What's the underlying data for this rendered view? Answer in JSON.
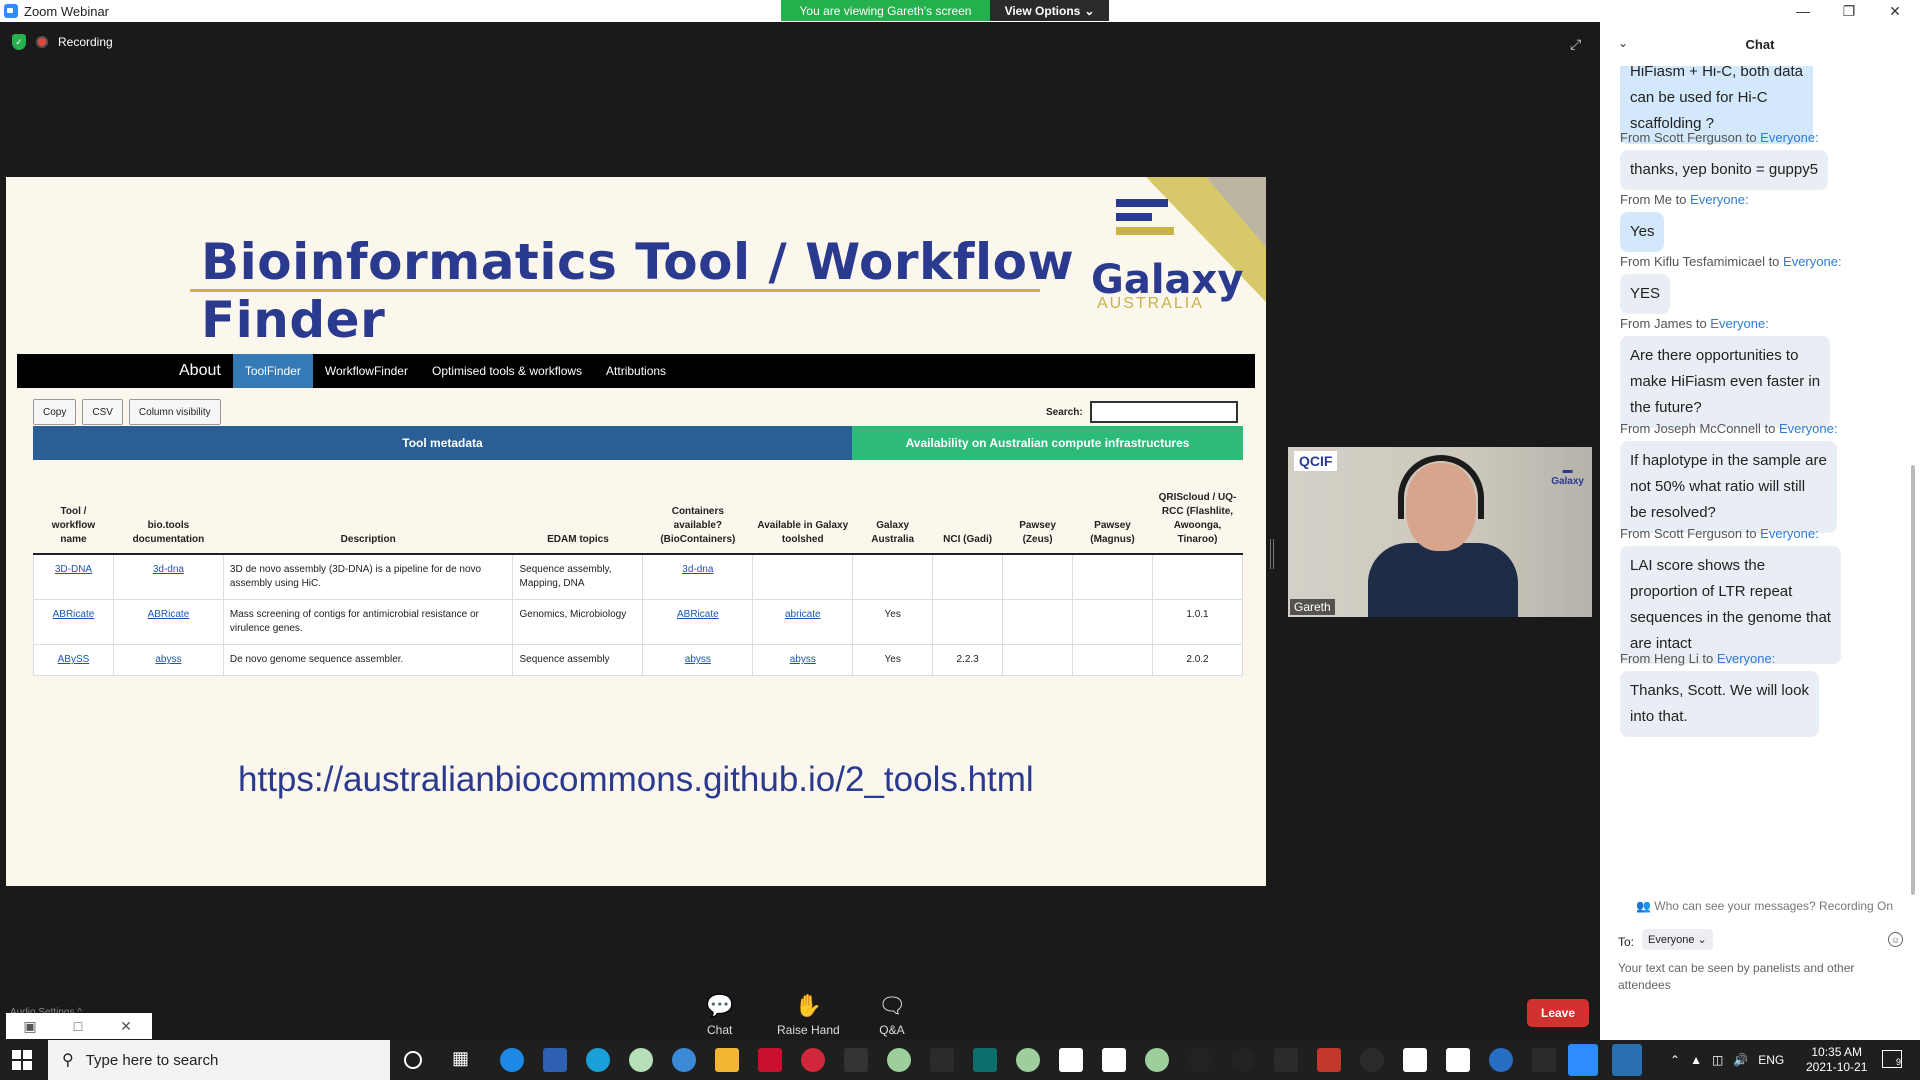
{
  "window": {
    "app_title": "Zoom Webinar"
  },
  "banner": {
    "viewing_text": "You are viewing Gareth's screen",
    "view_options_label": "View Options"
  },
  "meeting": {
    "recording_label": "Recording"
  },
  "slide": {
    "title": "Bioinformatics Tool  / Workflow Finder",
    "logo_name": "Galaxy",
    "logo_sub": "AUSTRALIA",
    "url": "https://australianbiocommons.github.io/2_tools.html",
    "nav": {
      "brand": "About",
      "items": [
        "ToolFinder",
        "WorkflowFinder",
        "Optimised tools & workflows",
        "Attributions"
      ]
    },
    "buttons": [
      "Copy",
      "CSV",
      "Column visibility"
    ],
    "search_label": "Search:",
    "band_meta": "Tool metadata",
    "band_avail": "Availability on Australian compute infrastructures",
    "table": {
      "headers": [
        "Tool / workflow name",
        "bio.tools documentation",
        "Description",
        "EDAM topics",
        "Containers available? (BioContainers)",
        "Available in Galaxy toolshed",
        "Galaxy Australia",
        "NCI (Gadi)",
        "Pawsey (Zeus)",
        "Pawsey (Magnus)",
        "QRIScloud / UQ-RCC (Flashlite, Awoonga, Tinaroo)"
      ],
      "rows": [
        [
          "3D-DNA",
          "3d-dna",
          "3D de novo assembly (3D-DNA) is a pipeline for de novo assembly using HiC.",
          "Sequence assembly, Mapping, DNA",
          "3d-dna",
          "",
          "",
          "",
          "",
          "",
          ""
        ],
        [
          "ABRicate",
          "ABRicate",
          "Mass screening of contigs for antimicrobial resistance or virulence genes.",
          "Genomics, Microbiology",
          "ABRicate",
          "abricate",
          "Yes",
          "",
          "",
          "",
          "1.0.1"
        ],
        [
          "ABySS",
          "abyss",
          "De novo genome sequence assembler.",
          "Sequence assembly",
          "abyss",
          "abyss",
          "Yes",
          "2.2.3",
          "",
          "",
          "2.0.2"
        ]
      ]
    }
  },
  "video": {
    "participant_name": "Gareth",
    "org_label": "QCIF",
    "tile_logo": "Galaxy"
  },
  "controls": {
    "chat": "Chat",
    "raise_hand": "Raise Hand",
    "qa": "Q&A",
    "leave": "Leave",
    "audio_settings": "Audio Settings ^"
  },
  "chat": {
    "header": "Chat",
    "partial_message": "HiFiasm + Hi-C, both data\ncan be used for Hi-C\nscaffolding ?",
    "messages": [
      {
        "from": "From Scott Ferguson to ",
        "to": "Everyone:",
        "text": "thanks, yep bonito = guppy5"
      },
      {
        "from": "From Me to ",
        "to": "Everyone:",
        "text": "Yes"
      },
      {
        "from": "From Kiflu Tesfamimicael to ",
        "to": "Everyone:",
        "text": "YES"
      },
      {
        "from": "From James to ",
        "to": "Everyone:",
        "text": "Are there opportunities to\nmake HiFiasm even faster in\nthe future?"
      },
      {
        "from": "From Joseph McConnell to ",
        "to": "Everyone:",
        "text": "If haplotype in the sample are\nnot 50% what ratio will still\nbe resolved?"
      },
      {
        "from": "From Scott Ferguson to ",
        "to": "Everyone:",
        "text": "LAI score shows the\nproportion of LTR repeat\nsequences in the genome that\nare intact"
      },
      {
        "from": "From Heng Li to ",
        "to": "Everyone:",
        "text": "Thanks, Scott. We will look\ninto that."
      }
    ],
    "who_can_see": "Who can see your messages? Recording On",
    "to_label": "To:",
    "to_value": "Everyone",
    "input_placeholder": "Your text can be seen by panelists and other attendees"
  },
  "taskbar": {
    "search_placeholder": "Type here to search",
    "language": "ENG",
    "time": "10:35 AM",
    "date": "2021-10-21",
    "notification_count": "9"
  }
}
